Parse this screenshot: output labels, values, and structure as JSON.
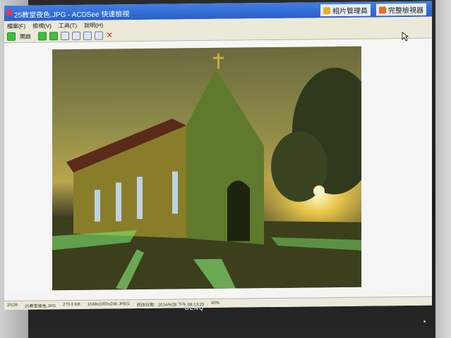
{
  "window": {
    "title": "25教堂夜色.JPG - ACDSee 快速檢視",
    "photo_manager_label": "相片管理員",
    "full_viewer_label": "完整檢視器"
  },
  "menu": [
    "檔案(F)",
    "檢視(V)",
    "工具(T)",
    "說明(H)"
  ],
  "toolbar": {
    "open_label": "開啟",
    "icons": [
      "open-icon",
      "prev-icon",
      "next-icon",
      "rotate-left-icon",
      "rotate-right-icon",
      "zoom-in-icon",
      "zoom-out-icon",
      "delete-icon"
    ]
  },
  "status": {
    "index": "25/26",
    "filename": "25教堂夜色.JPG",
    "size": "270.0 KB",
    "dimensions": "1048x1000x24b JPEG",
    "date": "修改日期：2014/6/28 下午 08:13:23",
    "zoom": "40%"
  },
  "monitor": {
    "brand": "BENQ"
  },
  "colors": {
    "titlebar": "#2a5fc8",
    "chrome": "#ece9d8",
    "accent": "#e8b024"
  }
}
